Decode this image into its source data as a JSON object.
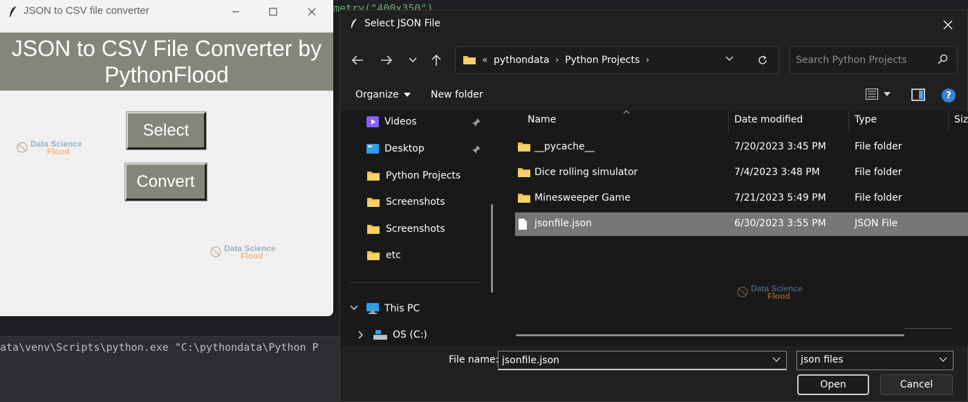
{
  "ide": {
    "code_fragment_1": "metry(\"400x350\")",
    "terminal_line": "ata\\venv\\Scripts\\python.exe \"C:\\pythondata\\Python P"
  },
  "tk_window": {
    "title": "JSON to CSV file converter",
    "banner_line1": "JSON to CSV File Converter by",
    "banner_line2": "PythonFlood",
    "select_label": "Select",
    "convert_label": "Convert",
    "bg_color": "#f0f0f0",
    "accent_color": "#85857a"
  },
  "watermark": {
    "line1": "Data Science",
    "line2": "Flood"
  },
  "dialog": {
    "title": "Select JSON File",
    "breadcrumb": {
      "overflow": "«",
      "items": [
        "pythondata",
        "Python Projects"
      ]
    },
    "search_placeholder": "Search Python Projects",
    "toolbar": {
      "organize_label": "Organize",
      "new_folder_label": "New folder",
      "help_label": "?"
    },
    "nav_items": [
      {
        "label": "Videos",
        "icon": "videos-icon",
        "pinned": true
      },
      {
        "label": "Desktop",
        "icon": "desktop-icon",
        "pinned": true
      },
      {
        "label": "Python Projects",
        "icon": "folder-icon",
        "pinned": false
      },
      {
        "label": "Screenshots",
        "icon": "folder-icon",
        "pinned": false
      },
      {
        "label": "Screenshots",
        "icon": "folder-icon",
        "pinned": false
      },
      {
        "label": "etc",
        "icon": "folder-icon",
        "pinned": false
      }
    ],
    "this_pc_label": "This PC",
    "drive_label": "OS (C:)",
    "columns": [
      "Name",
      "Date modified",
      "Type",
      "Siz"
    ],
    "files": [
      {
        "name": "__pycache__",
        "date": "7/20/2023 3:45 PM",
        "type": "File folder",
        "kind": "folder"
      },
      {
        "name": "Dice rolling simulator",
        "date": "7/4/2023 3:48 PM",
        "type": "File folder",
        "kind": "folder"
      },
      {
        "name": "Minesweeper Game",
        "date": "7/21/2023 5:49 PM",
        "type": "File folder",
        "kind": "folder"
      },
      {
        "name": "jsonfile.json",
        "date": "6/30/2023 3:55 PM",
        "type": "JSON File",
        "kind": "file"
      }
    ],
    "selected_file_index": 3,
    "file_name_label": "File name:",
    "file_name_value": "jsonfile.json",
    "file_type_value": "json files",
    "open_label": "Open",
    "cancel_label": "Cancel",
    "folder_color": "#f0c24b",
    "selection_color": "#777777"
  }
}
